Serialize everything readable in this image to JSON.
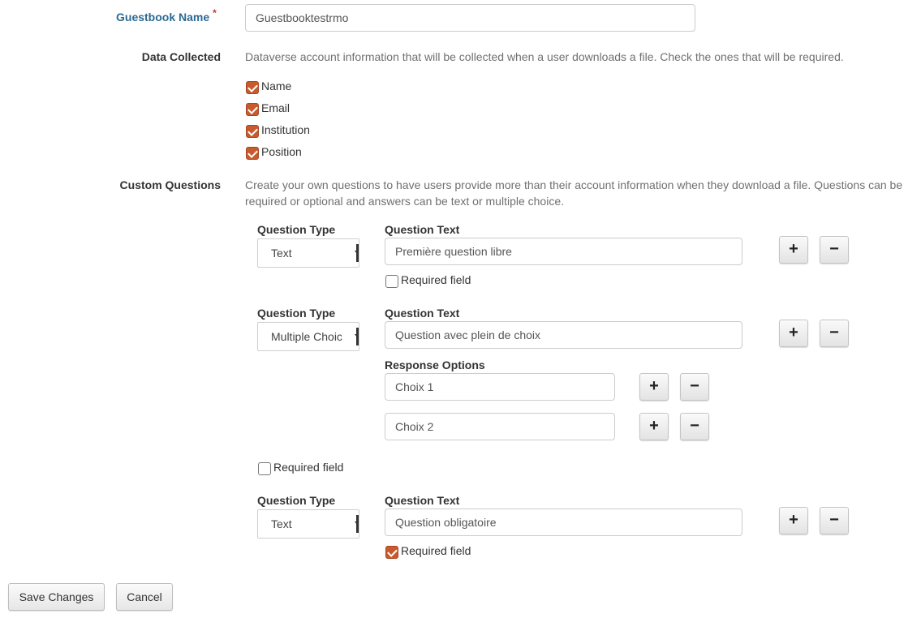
{
  "guestbook": {
    "label": "Guestbook Name",
    "required_mark": "*",
    "value": "Guestbooktestrmo"
  },
  "data_collected": {
    "label": "Data Collected",
    "help": "Dataverse account information that will be collected when a user downloads a file. Check the ones that will be required.",
    "items": [
      {
        "label": "Name",
        "checked": true
      },
      {
        "label": "Email",
        "checked": true
      },
      {
        "label": "Institution",
        "checked": true
      },
      {
        "label": "Position",
        "checked": true
      }
    ]
  },
  "custom_questions": {
    "label": "Custom Questions",
    "help_line1": "Create your own questions to have users provide more than their account information when they download a file. Questions can be",
    "help_line2": "required or optional and answers can be text or multiple choice.",
    "type_label": "Question Type",
    "text_label": "Question Text",
    "required_label": "Required field",
    "response_options_label": "Response Options",
    "add": "+",
    "remove": "−",
    "questions": [
      {
        "type": "Text",
        "text": "Première question libre",
        "required": false
      },
      {
        "type": "Multiple Choic",
        "text": "Question avec plein de choix",
        "required": false,
        "options": [
          "Choix 1",
          "Choix 2"
        ]
      },
      {
        "type": "Text",
        "text": "Question obligatoire",
        "required": true
      }
    ]
  },
  "actions": {
    "save": "Save Changes",
    "cancel": "Cancel"
  },
  "colors": {
    "accent": "#c85a2e",
    "link_label": "#2b6a94"
  }
}
